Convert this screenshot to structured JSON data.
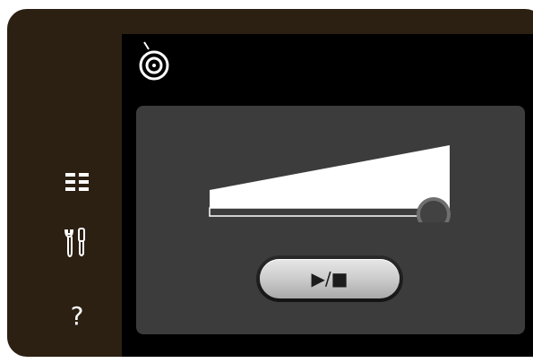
{
  "header": {
    "icon": "bobbin-icon"
  },
  "sidebar": {
    "items": [
      {
        "icon": "menu-list-icon"
      },
      {
        "icon": "settings-tools-icon"
      },
      {
        "icon": "help-icon",
        "glyph": "?"
      }
    ]
  },
  "panel": {
    "speed_slider": {
      "icon": "speed-slider-icon",
      "level": 0.9
    },
    "play_stop": {
      "label": "▶/■"
    }
  },
  "colors": {
    "bezel": "#2b2012",
    "screen": "#000000",
    "panel": "#3c3c3c",
    "icon": "#ffffff"
  }
}
